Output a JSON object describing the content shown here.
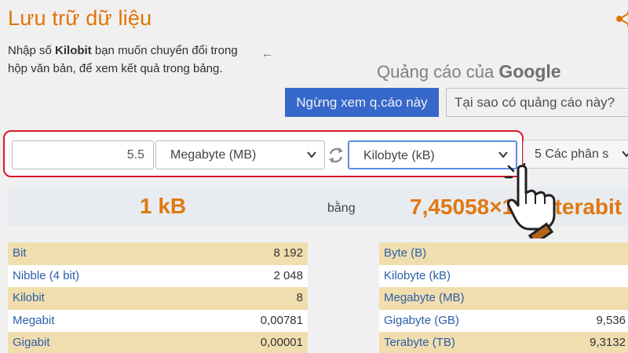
{
  "page": {
    "title": "Lưu trữ dữ liệu"
  },
  "instructions": {
    "prefix": "Nhập số ",
    "unit": "Kilobit",
    "suffix": " bạn muốn chuyển đổi trong hộp văn bản, để xem kết quả trong bảng."
  },
  "ad": {
    "back_glyph": "←",
    "label_prefix": "Quảng cáo của ",
    "label_brand": "Google",
    "stop_button": "Ngừng xem q.cáo này",
    "why_button": "Tại sao có quảng cáo này?"
  },
  "converter": {
    "value": "5.5",
    "from_unit": "Megabyte (MB)",
    "to_unit": "Kilobyte (kB)",
    "precision": "5 Các phân s"
  },
  "result": {
    "left": "1 kB",
    "middle": "bằng",
    "right": "7,45058×10⁻⁹ terabit"
  },
  "table_left": [
    {
      "name": "Bit",
      "value": "8 192"
    },
    {
      "name": "Nibble (4 bit)",
      "value": "2 048"
    },
    {
      "name": "Kilobit",
      "value": "8"
    },
    {
      "name": "Megabit",
      "value": "0,00781"
    },
    {
      "name": "Gigabit",
      "value": "0,00001"
    }
  ],
  "table_right": [
    {
      "name": "Byte (B)",
      "value": ""
    },
    {
      "name": "Kilobyte (kB)",
      "value": ""
    },
    {
      "name": "Megabyte (MB)",
      "value": ""
    },
    {
      "name": "Gigabyte (GB)",
      "value": "9,536"
    },
    {
      "name": "Terabyte (TB)",
      "value": "9,3132"
    }
  ],
  "colors": {
    "accent": "#f07d05",
    "highlight_border": "#d9182b",
    "ad_button": "#3a6fd8",
    "row_highlight": "#f0deaf",
    "link": "#2d5ea8"
  },
  "icons": {
    "share": "share-icon",
    "swap": "swap-arrows-icon",
    "dropdown": "chevron-down-icon",
    "pointer": "pointing-hand-icon"
  }
}
